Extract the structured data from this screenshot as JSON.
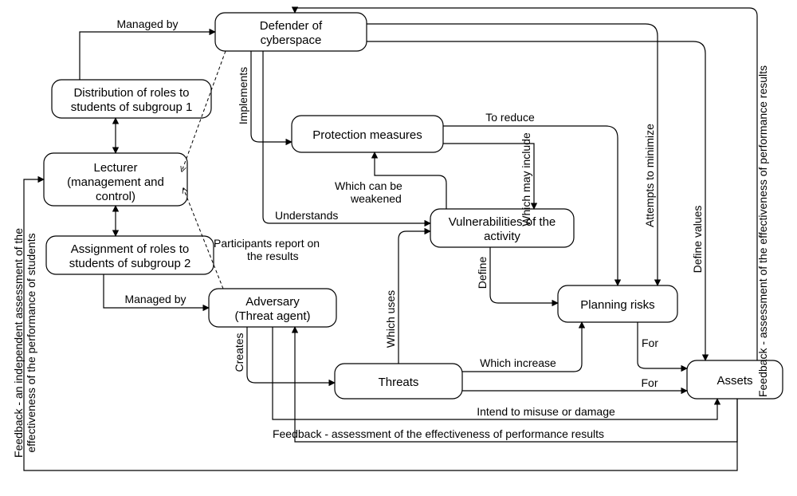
{
  "nodes": {
    "defender": "Defender of cyberspace",
    "dist_roles": "Distribution of roles to students of subgroup 1",
    "lecturer": "Lecturer (management and control)",
    "assign_roles": "Assignment of roles to students of subgroup 2",
    "protection": "Protection measures",
    "vulnerabilities": "Vulnerabilities of the activity",
    "adversary": "Adversary (Threat agent)",
    "planning": "Planning risks",
    "threats": "Threats",
    "assets": "Assets"
  },
  "edges": {
    "managed_by_1": "Managed by",
    "managed_by_2": "Managed by",
    "implements": "Implements",
    "to_reduce": "To reduce",
    "which_include": "Which may include",
    "which_weakened": "Which can be weakened",
    "understands": "Understands",
    "participants": "Participants report on the results",
    "creates": "Creates",
    "which_uses": "Which uses",
    "define": "Define",
    "which_increase": "Which increase",
    "for_1": "For",
    "for_2": "For",
    "attempts_min": "Attempts to minimize",
    "define_values": "Define values",
    "intend_misuse": "Intend to misuse or damage",
    "feedback_right": "Feedback - assessment of the effectiveness of performance results",
    "feedback_left": "Feedback - an independent assessment of the effectiveness of the performance of students",
    "feedback_bottom": "Feedback - assessment of the effectiveness of performance results"
  }
}
